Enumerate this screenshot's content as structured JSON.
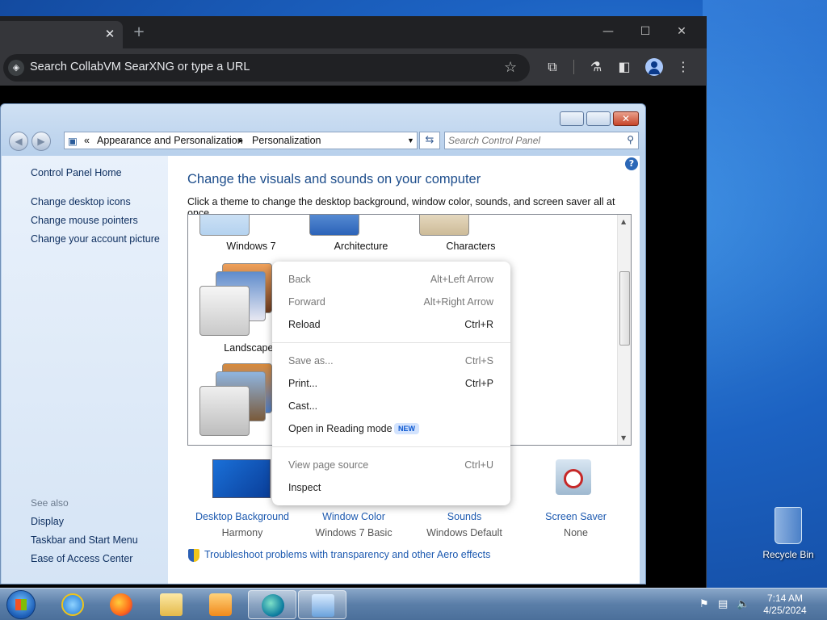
{
  "browser": {
    "omnibox_placeholder": "Search CollabVM SearXNG or type a URL",
    "tab_close": "✕",
    "new_tab": "+",
    "minimize": "—",
    "maximize": "☐",
    "close": "✕"
  },
  "control_panel": {
    "breadcrumb": {
      "root_glyph": "«",
      "crumb1": "Appearance and Personalization",
      "arrow": "▸",
      "crumb2": "Personalization"
    },
    "search_placeholder": "Search Control Panel",
    "sidebar": {
      "home": "Control Panel Home",
      "links": [
        "Change desktop icons",
        "Change mouse pointers",
        "Change your account picture"
      ],
      "see_also_title": "See also",
      "see_also": [
        "Display",
        "Taskbar and Start Menu",
        "Ease of Access Center"
      ]
    },
    "heading": "Change the visuals and sounds on your computer",
    "subheading": "Click a theme to change the desktop background, window color, sounds, and screen saver all at once.",
    "themes": [
      "Windows 7",
      "Architecture",
      "Characters",
      "Landscapes"
    ],
    "bottom": [
      {
        "label": "Desktop Background",
        "value": "Harmony"
      },
      {
        "label": "Window Color",
        "value": "Windows 7 Basic"
      },
      {
        "label": "Sounds",
        "value": "Windows Default"
      },
      {
        "label": "Screen Saver",
        "value": "None"
      }
    ],
    "troubleshoot": "Troubleshoot problems with transparency and other Aero effects"
  },
  "context_menu": {
    "items": [
      {
        "label": "Back",
        "shortcut": "Alt+Left Arrow"
      },
      {
        "label": "Forward",
        "shortcut": "Alt+Right Arrow"
      },
      {
        "label": "Reload",
        "shortcut": "Ctrl+R"
      },
      {
        "label": "Save as...",
        "shortcut": "Ctrl+S"
      },
      {
        "label": "Print...",
        "shortcut": "Ctrl+P"
      },
      {
        "label": "Cast...",
        "shortcut": ""
      },
      {
        "label": "Open in Reading mode",
        "shortcut": ""
      },
      {
        "label": "View page source",
        "shortcut": "Ctrl+U"
      },
      {
        "label": "Inspect",
        "shortcut": ""
      }
    ],
    "badge": "NEW"
  },
  "desktop": {
    "recycle_bin": "Recycle Bin"
  },
  "taskbar": {
    "time": "7:14 AM",
    "date": "4/25/2024"
  }
}
